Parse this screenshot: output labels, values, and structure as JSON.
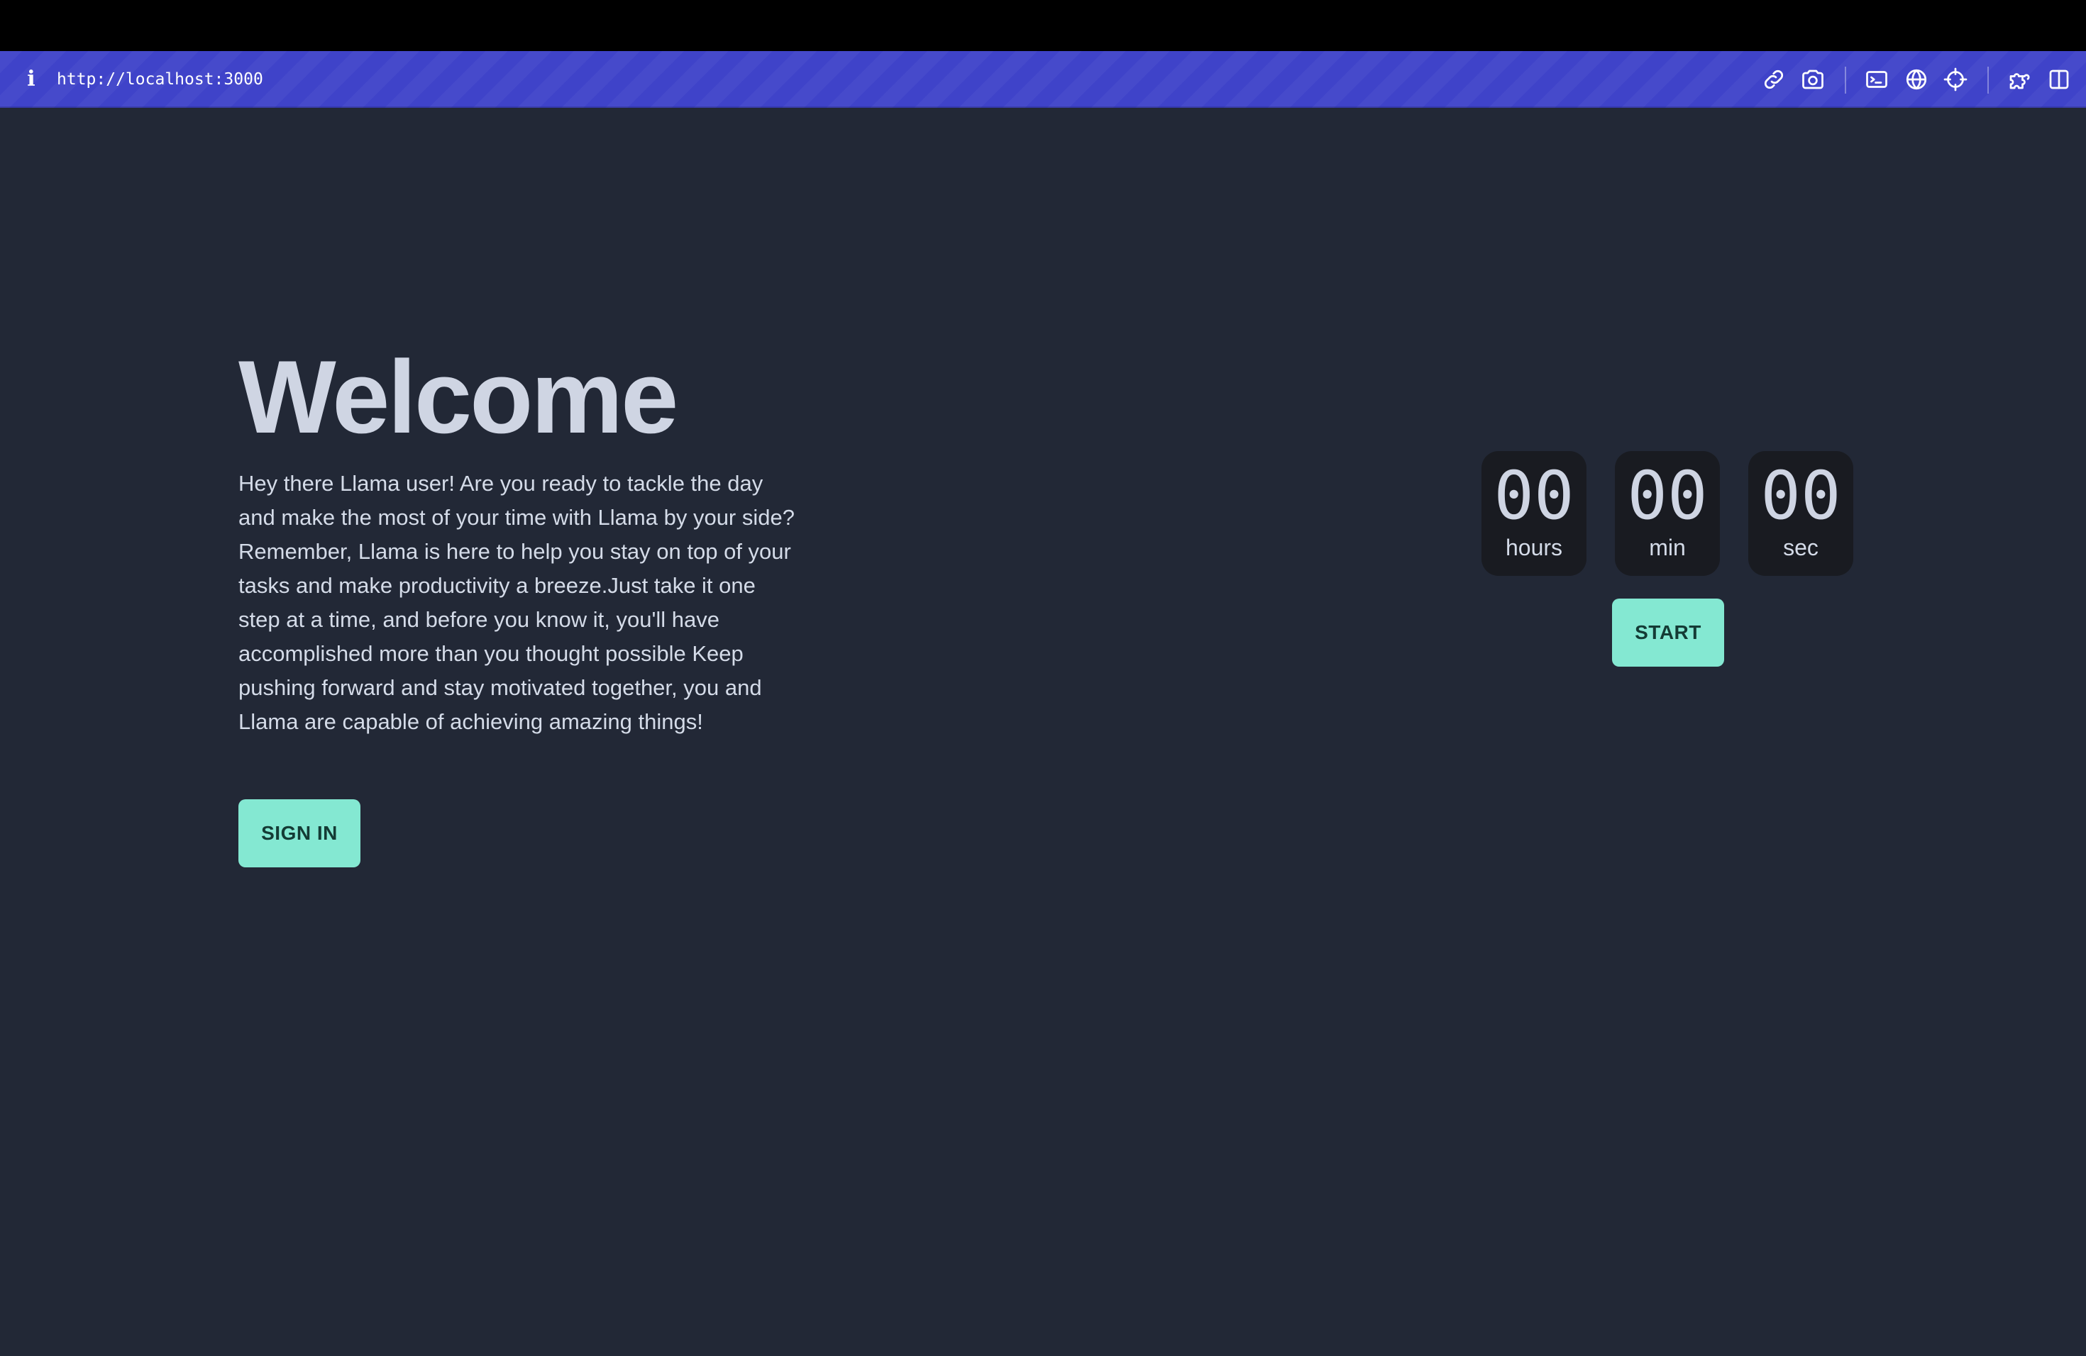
{
  "browser": {
    "url": "http://localhost:3000",
    "info_icon": "i",
    "toolbar_icons": [
      "link-icon",
      "camera-icon",
      "terminal-icon",
      "globe-icon",
      "crosshair-icon",
      "extension-icon",
      "split-view-icon"
    ]
  },
  "hero": {
    "title": "Welcome",
    "description": "Hey there Llama user! Are you ready to tackle the day and make the most of your time with Llama by your side? Remember, Llama is here to help you stay on top of your tasks and make productivity a breeze.Just take it one step at a time, and before you know it, you'll have accomplished more than you thought possible Keep pushing forward and stay motivated together, you and Llama are capable of achieving amazing things!",
    "sign_in_label": "SIGN IN"
  },
  "timer": {
    "hours": {
      "value": "00",
      "label": "hours"
    },
    "minutes": {
      "value": "00",
      "label": "min"
    },
    "seconds": {
      "value": "00",
      "label": "sec"
    },
    "start_label": "START"
  },
  "colors": {
    "page_background": "#222836",
    "browser_bar": "#3f43c9",
    "accent_button": "#84e8d2",
    "timer_box": "#191b21",
    "heading_text": "#cfd5e3"
  }
}
